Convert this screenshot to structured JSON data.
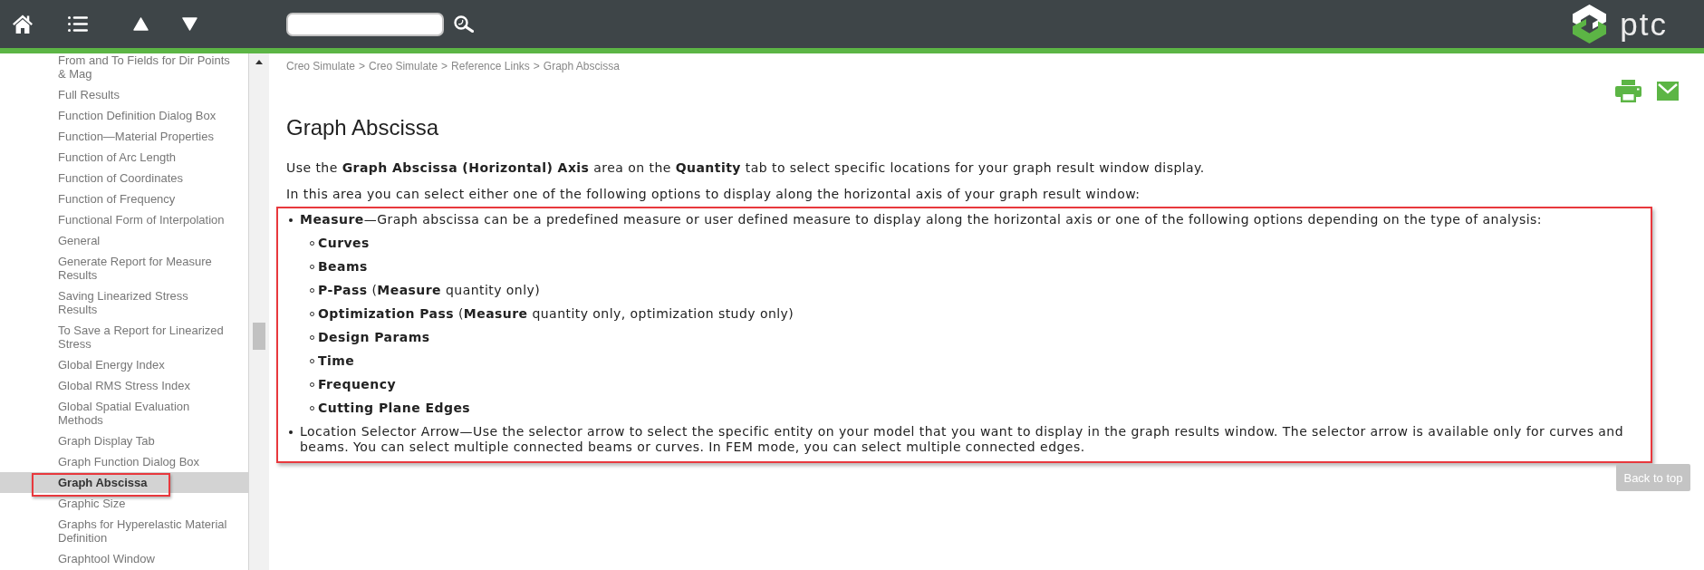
{
  "header": {
    "logo": {
      "text": "ptc"
    }
  },
  "sidebar": {
    "items": [
      {
        "label": "From and To Fields for Dir Points & Mag",
        "selected": false,
        "outlined": false
      },
      {
        "label": "Full Results",
        "selected": false,
        "outlined": false
      },
      {
        "label": "Function Definition Dialog Box",
        "selected": false,
        "outlined": false
      },
      {
        "label": "Function—Material Properties",
        "selected": false,
        "outlined": false
      },
      {
        "label": "Function of Arc Length",
        "selected": false,
        "outlined": false
      },
      {
        "label": "Function of Coordinates",
        "selected": false,
        "outlined": false
      },
      {
        "label": "Function of Frequency",
        "selected": false,
        "outlined": false
      },
      {
        "label": "Functional Form of Interpolation",
        "selected": false,
        "outlined": false
      },
      {
        "label": "General",
        "selected": false,
        "outlined": false
      },
      {
        "label": "Generate Report for Measure Results",
        "selected": false,
        "outlined": false
      },
      {
        "label": "Saving Linearized Stress Results",
        "selected": false,
        "outlined": false
      },
      {
        "label": "To Save a Report for Linearized Stress",
        "selected": false,
        "outlined": false
      },
      {
        "label": "Global Energy Index",
        "selected": false,
        "outlined": false
      },
      {
        "label": "Global RMS Stress Index",
        "selected": false,
        "outlined": false
      },
      {
        "label": "Global Spatial Evaluation Methods",
        "selected": false,
        "outlined": false
      },
      {
        "label": "Graph Display Tab",
        "selected": false,
        "outlined": false
      },
      {
        "label": "Graph Function Dialog Box",
        "selected": false,
        "outlined": false
      },
      {
        "label": "Graph Abscissa",
        "selected": true,
        "outlined": true
      },
      {
        "label": "Graphic Size",
        "selected": false,
        "outlined": false
      },
      {
        "label": "Graphs for Hyperelastic Material Definition",
        "selected": false,
        "outlined": false
      },
      {
        "label": "Graphtool Window",
        "selected": false,
        "outlined": false
      }
    ]
  },
  "breadcrumb": {
    "links": [
      "Creo Simulate",
      "Creo Simulate",
      "Reference Links",
      "Graph Abscissa"
    ],
    "separators": [
      ">",
      ">",
      ">"
    ]
  },
  "article": {
    "title": "Graph Abscissa",
    "paragraphs": [
      "Use the **Graph Abscissa (Horizontal) Axis** area on the **Quantity** tab to select specific locations for your graph result window display.",
      "In this area you can select either one of the following options to display along the horizontal axis of your graph result window:"
    ],
    "options": {
      "outlined": true,
      "items": [
        {
          "text": "**Measure**—Graph abscissa can be a predefined measure or user defined measure to display along the horizontal axis or one of the following options depending on the type of analysis:",
          "children": [
            {
              "label": "Curves"
            },
            {
              "label": "Beams"
            },
            {
              "label": "P-Pass",
              "note": "(**Measure** quantity only)"
            },
            {
              "label": "Optimization Pass",
              "note": "(**Measure** quantity only, optimization study only)"
            },
            {
              "label": "Design Params"
            },
            {
              "label": "Time"
            },
            {
              "label": "Frequency"
            },
            {
              "label": "Cutting Plane Edges"
            }
          ]
        },
        {
          "text": "Location Selector Arrow—Use the selector arrow to select the specific entity on your model that you want to display in the graph results window. The selector arrow is available only for curves and beams. You can select multiple connected beams or curves. In FEM mode, you can select multiple connected edges."
        }
      ]
    }
  },
  "back_to_top": {
    "label": "Back to top"
  }
}
